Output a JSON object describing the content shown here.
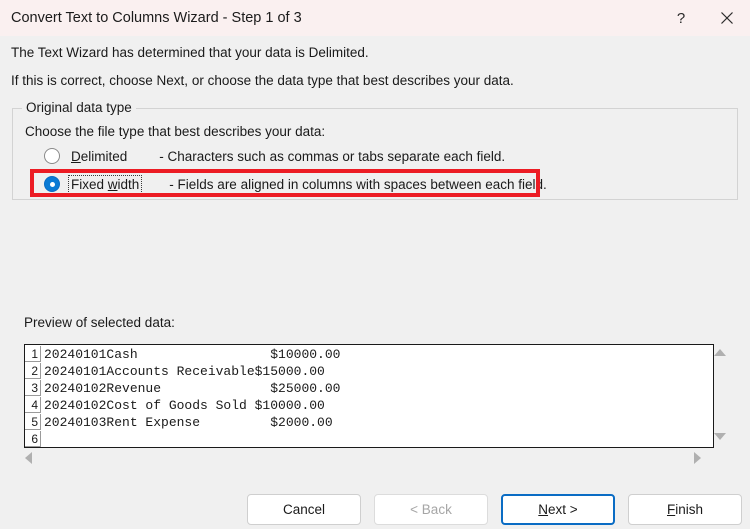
{
  "titlebar": {
    "title": "Convert Text to Columns Wizard - Step 1 of 3",
    "help_label": "?",
    "close_label": "×"
  },
  "intro": {
    "line1": "The Text Wizard has determined that your data is Delimited.",
    "line2": "If this is correct, choose Next, or choose the data type that best describes your data."
  },
  "original_data_type": {
    "legend": "Original data type",
    "prompt": "Choose the file type that best describes your data:",
    "options": [
      {
        "label_before": "",
        "accel": "D",
        "label_after": "elimited",
        "description": "- Characters such as commas or tabs separate each field.",
        "selected": false,
        "focused": false
      },
      {
        "label_before": "Fixed ",
        "accel": "w",
        "label_after": "idth",
        "description": "- Fields are aligned in columns with spaces between each field.",
        "selected": true,
        "focused": true
      }
    ],
    "highlight_color": "#ec1c24"
  },
  "preview": {
    "label": "Preview of selected data:",
    "rows": [
      {
        "num": "1",
        "text": "20240101Cash                 $10000.00"
      },
      {
        "num": "2",
        "text": "20240101Accounts Receivable$15000.00"
      },
      {
        "num": "3",
        "text": "20240102Revenue              $25000.00"
      },
      {
        "num": "4",
        "text": "20240102Cost of Goods Sold $10000.00"
      },
      {
        "num": "5",
        "text": "20240103Rent Expense         $2000.00"
      },
      {
        "num": "6",
        "text": ""
      }
    ]
  },
  "scrollbars": {
    "up_arrow": "scroll-up-arrow",
    "down_arrow": "scroll-down-arrow",
    "left_arrow": "scroll-left-arrow",
    "right_arrow": "scroll-right-arrow"
  },
  "footer": {
    "cancel": "Cancel",
    "back": "< Back",
    "next_before": "",
    "next_accel": "N",
    "next_after": "ext >",
    "finish_before": "",
    "finish_accel": "F",
    "finish_after": "inish",
    "back_disabled": true,
    "next_is_default": true,
    "default_border_color": "#0a6cc4"
  },
  "colors": {
    "titlebar_bg": "#faf0f0",
    "dialog_bg": "#f0f0f0",
    "accent_blue": "#0a7ad4",
    "annotation_red": "#ec1c24"
  }
}
